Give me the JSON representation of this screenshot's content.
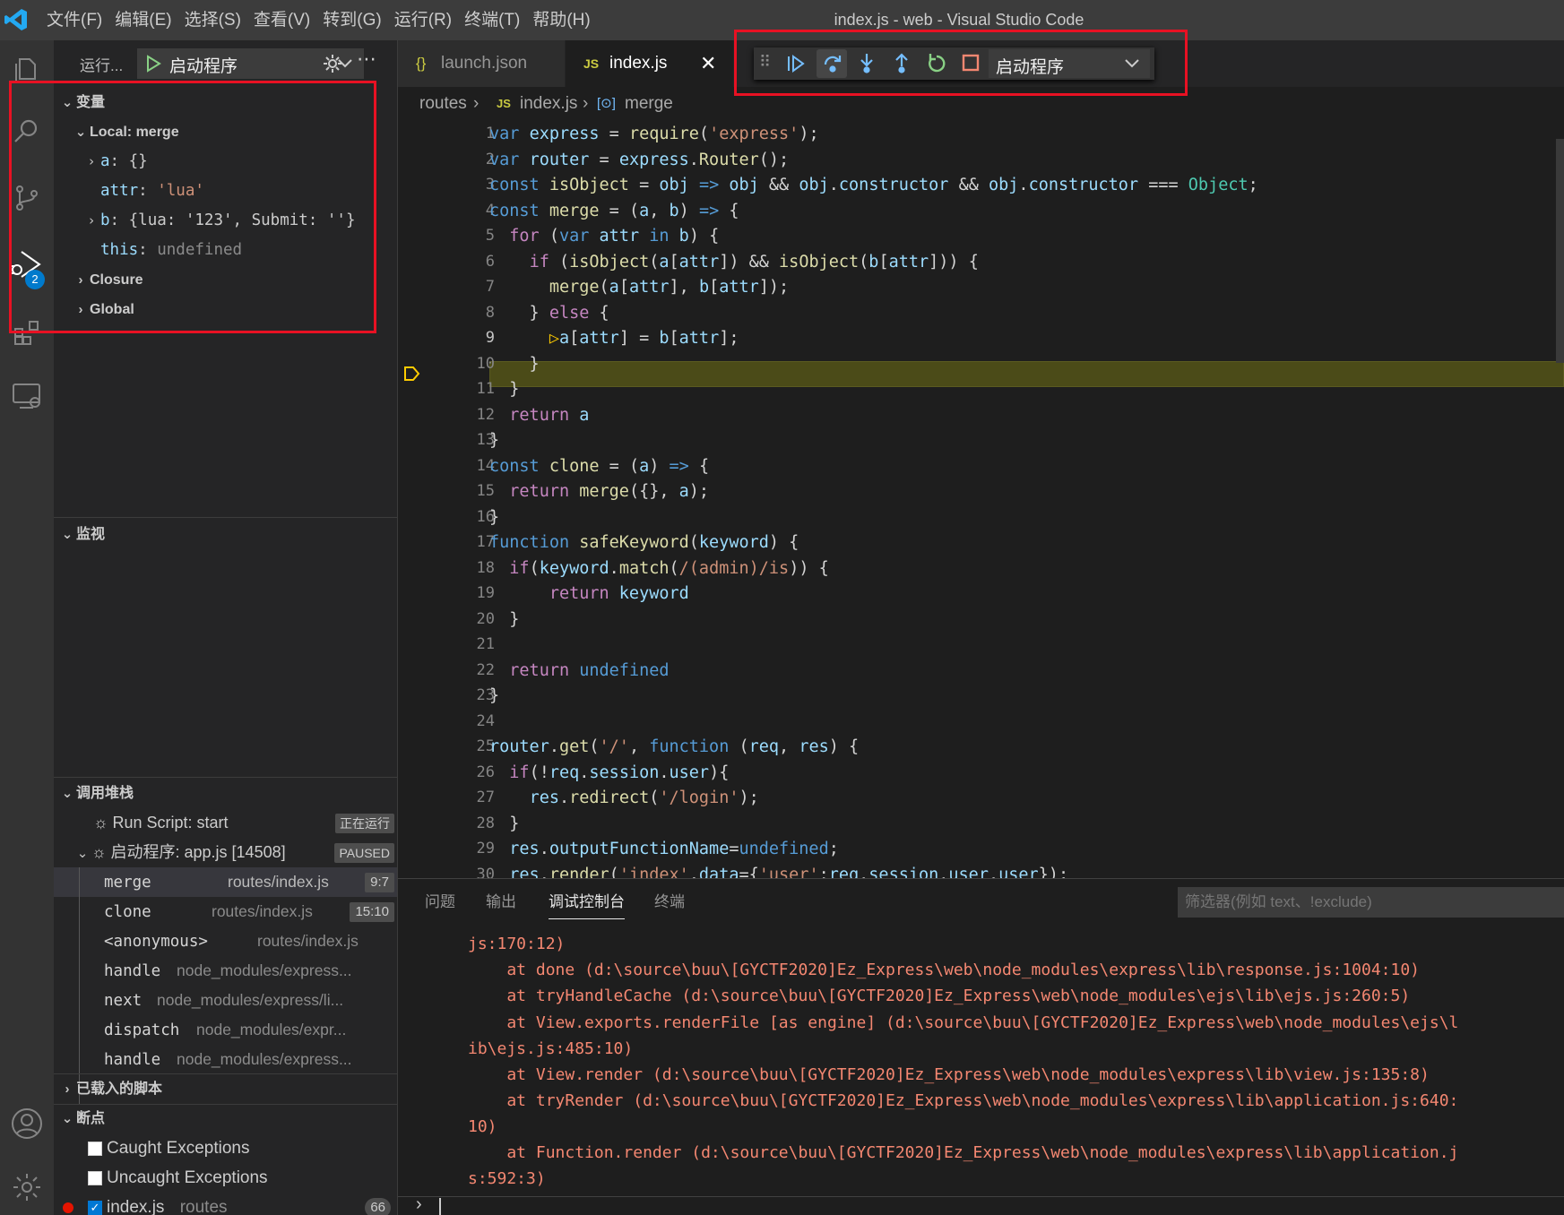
{
  "app": {
    "title": "index.js - web - Visual Studio Code",
    "menus": [
      "文件(F)",
      "编辑(E)",
      "选择(S)",
      "查看(V)",
      "转到(G)",
      "运行(R)",
      "终端(T)",
      "帮助(H)"
    ]
  },
  "activity": {
    "debug_badge": "2"
  },
  "sidebar": {
    "run_label": "运行...",
    "config_name": "启动程序",
    "variables": {
      "title": "变量",
      "local_scope": "Local: merge",
      "items": [
        {
          "name": "a",
          "value": "{}"
        },
        {
          "name": "attr",
          "value": "'lua'"
        },
        {
          "name": "b",
          "value": "{lua: '123', Submit: ''}"
        },
        {
          "name": "this",
          "value": "undefined"
        }
      ],
      "closure": "Closure",
      "global": "Global"
    },
    "watch": {
      "title": "监视"
    },
    "callstack": {
      "title": "调用堆栈",
      "sessions": [
        {
          "name": "Run Script: start",
          "status": "正在运行"
        },
        {
          "name": "启动程序: app.js [14508]",
          "status": "PAUSED"
        }
      ],
      "frames": [
        {
          "fn": "merge",
          "file": "routes/index.js",
          "pos": "9:7"
        },
        {
          "fn": "clone",
          "file": "routes/index.js",
          "pos": "15:10"
        },
        {
          "fn": "<anonymous>",
          "file": "routes/index.js",
          "pos": ""
        },
        {
          "fn": "handle",
          "file": "node_modules/express...",
          "pos": ""
        },
        {
          "fn": "next",
          "file": "node_modules/express/li...",
          "pos": ""
        },
        {
          "fn": "dispatch",
          "file": "node_modules/expr...",
          "pos": ""
        },
        {
          "fn": "handle",
          "file": "node_modules/express...",
          "pos": ""
        }
      ]
    },
    "loaded_scripts": {
      "title": "已载入的脚本"
    },
    "breakpoints": {
      "title": "断点",
      "items": [
        {
          "label": "Caught Exceptions",
          "checked": false
        },
        {
          "label": "Uncaught Exceptions",
          "checked": false
        },
        {
          "label": "index.js",
          "path": "routes",
          "line": "66",
          "checked": true
        }
      ]
    }
  },
  "editor": {
    "tabs": [
      {
        "icon": "{}",
        "label": "launch.json",
        "active": false
      },
      {
        "icon": "JS",
        "label": "index.js",
        "active": true
      }
    ],
    "breadcrumb": [
      "routes",
      "index.js",
      "merge"
    ],
    "current_line": 9,
    "line_numbers": [
      "1",
      "2",
      "3",
      "4",
      "5",
      "6",
      "7",
      "8",
      "9",
      "10",
      "11",
      "12",
      "13",
      "14",
      "15",
      "16",
      "17",
      "18",
      "19",
      "20",
      "21",
      "22",
      "23",
      "24",
      "25",
      "26",
      "27",
      "28",
      "29",
      "30"
    ]
  },
  "debug_toolbar": {
    "config": "启动程序",
    "buttons": [
      "continue",
      "step-over",
      "step-into",
      "step-out",
      "restart",
      "stop"
    ]
  },
  "panel": {
    "tabs": [
      "问题",
      "输出",
      "调试控制台",
      "终端"
    ],
    "active_tab": "调试控制台",
    "filter_placeholder": "筛选器(例如 text、!exclude)",
    "console_lines": [
      "js:170:12)",
      "    at done (d:\\source\\buu\\[GYCTF2020]Ez_Express\\web\\node_modules\\express\\lib\\response.js:1004:10)",
      "    at tryHandleCache (d:\\source\\buu\\[GYCTF2020]Ez_Express\\web\\node_modules\\ejs\\lib\\ejs.js:260:5)",
      "    at View.exports.renderFile [as engine] (d:\\source\\buu\\[GYCTF2020]Ez_Express\\web\\node_modules\\ejs\\l",
      "ib\\ejs.js:485:10)",
      "    at View.render (d:\\source\\buu\\[GYCTF2020]Ez_Express\\web\\node_modules\\express\\lib\\view.js:135:8)",
      "    at tryRender (d:\\source\\buu\\[GYCTF2020]Ez_Express\\web\\node_modules\\express\\lib\\application.js:640:",
      "10)",
      "    at Function.render (d:\\source\\buu\\[GYCTF2020]Ez_Express\\web\\node_modules\\express\\lib\\application.j",
      "s:592:3)"
    ]
  },
  "colors": {
    "accent": "#007acc",
    "annotation_red": "#e81123",
    "current_line_bg": "#4b4b18",
    "error_text": "#f48771"
  }
}
